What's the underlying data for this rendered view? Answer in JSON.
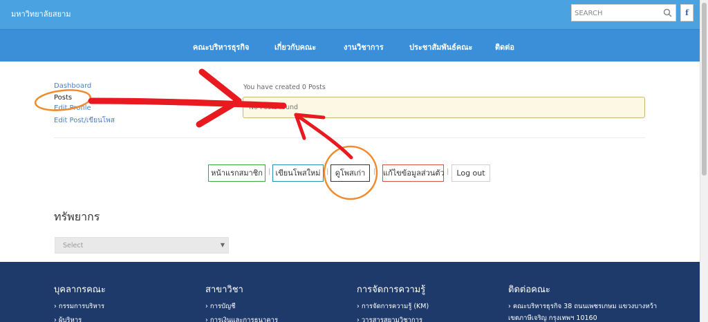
{
  "header": {
    "site_name": "มหาวิทยาลัยสยาม",
    "search_placeholder": "SEARCH",
    "facebook_glyph": "f"
  },
  "nav": {
    "items": [
      "คณะบริหารธุรกิจ",
      "เกี่ยวกับคณะ",
      "งานวิชาการ",
      "ประชาสัมพันธ์คณะ",
      "ติดต่อ"
    ]
  },
  "sidebar": {
    "items": [
      "Dashboard",
      "Posts",
      "Edit Profile",
      "Edit Post/เขียนโพส"
    ]
  },
  "main": {
    "created_text": "You have created 0 Posts",
    "alert_text": "No Posts found"
  },
  "actions": {
    "buttons": [
      "หน้าแรกสมาชิก",
      "เขียนโพสใหม่",
      "ดูโพสเก่า",
      "แก้ไขข้อมูลส่วนตัว",
      "Log out"
    ],
    "separator": "|"
  },
  "resources": {
    "title": "ทรัพยากร",
    "select_value": "Select"
  },
  "footer": {
    "columns": [
      {
        "title": "บุคลากรคณะ",
        "items": [
          "› กรรมการบริหาร",
          "› ผู้บริหาร"
        ]
      },
      {
        "title": "สาขาวิชา",
        "items": [
          "› การบัญชี",
          "› การเงินและการธนาคาร"
        ]
      },
      {
        "title": "การจัดการความรู้",
        "items": [
          "› การจัดการความรู้ (KM)",
          "› วารสารสยามวิชาการ"
        ]
      },
      {
        "title": "ติดต่อคณะ",
        "items": [
          "› คณะบริหารธุรกิจ 38 ถนนเพชรเกษม แขวงบางหว้า",
          "เขตภาษีเจริญ กรุงเทพฯ 10160"
        ]
      }
    ]
  },
  "colors": {
    "topbar": "#4aa3e0",
    "navbar": "#3a8fd8",
    "footer": "#1e3a6b",
    "alert_bg": "#fcf8e3",
    "annotation_red": "#e8191f",
    "annotation_orange": "#f08a2c"
  }
}
